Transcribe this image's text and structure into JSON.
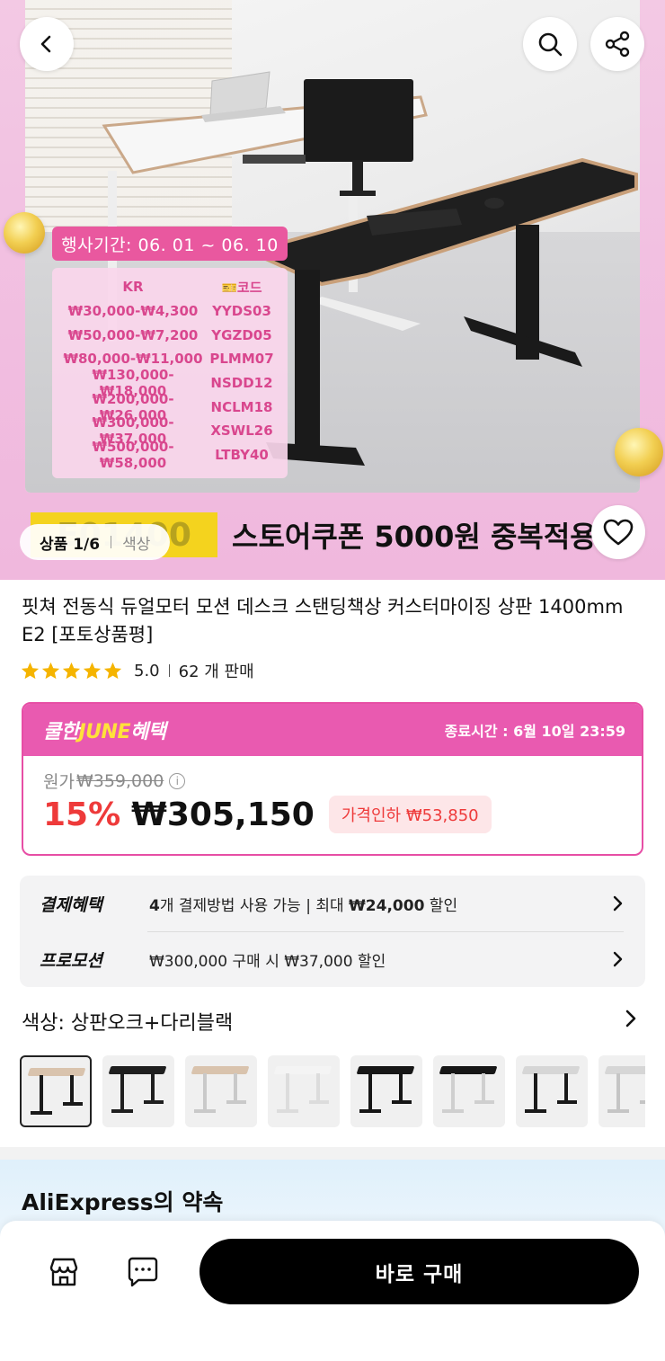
{
  "hero": {
    "event_period": "행사기간: 06. 01 ~ 06. 10",
    "coupon_header": {
      "range": "KR",
      "code": "코드"
    },
    "coupons": [
      {
        "range": "₩30,000-₩4,300",
        "code": "YYDS03"
      },
      {
        "range": "₩50,000-₩7,200",
        "code": "YGZD05"
      },
      {
        "range": "₩80,000-₩11,000",
        "code": "PLMM07"
      },
      {
        "range": "₩130,000-₩18,000",
        "code": "NSDD12"
      },
      {
        "range": "₩200,000-₩26,000",
        "code": "NCLM18"
      },
      {
        "range": "₩300,000-₩37,000",
        "code": "XSWL26"
      },
      {
        "range": "₩500,000-₩58,000",
        "code": "LTBY40"
      }
    ],
    "code_box": "E01400",
    "store_coupon": "스토어쿠폰 5000원 중복적용",
    "pager": {
      "label": "상품 1/6",
      "option": "색상"
    }
  },
  "product": {
    "title": "핏쳐 전동식 듀얼모터 모션 데스크 스탠딩책상 커스터마이징 상판 1400mm E2 [포토상품평]",
    "rating": "5.0",
    "sold": "62 개 판매"
  },
  "june": {
    "logo_pre": "쿨한",
    "logo_mid": "JUNE",
    "logo_post": "혜택",
    "end_time": "종료시간 : 6월 10일 23:59",
    "orig_label": "원가",
    "orig_price": "₩359,000",
    "discount": "15%",
    "price": "₩305,150",
    "price_cut": "가격인하 ₩53,850"
  },
  "benefits": {
    "pay_label": "결제혜택",
    "pay_count": "4",
    "pay_text_1": "개 결제방법 사용 가능 | 최대 ",
    "pay_amount": "₩24,000",
    "pay_text_2": " 할인",
    "promo_label": "프로모션",
    "promo_text": "₩300,000 구매 시 ₩37,000 할인"
  },
  "color": {
    "title": "색상: 상판오크+다리블랙",
    "swatches": [
      {
        "top": "#d9c3ad",
        "leg": "#1a1a1a"
      },
      {
        "top": "#1f1f1f",
        "leg": "#1f1f1f"
      },
      {
        "top": "#d9c3ad",
        "leg": "#c9c9c9"
      },
      {
        "top": "#f4f4f4",
        "leg": "#dcdcdc"
      },
      {
        "top": "#161616",
        "leg": "#161616"
      },
      {
        "top": "#161616",
        "leg": "#cfcfcf"
      },
      {
        "top": "#d6d6d6",
        "leg": "#1a1a1a"
      },
      {
        "top": "#d6d6d6",
        "leg": "#c5c5c5"
      }
    ]
  },
  "promise": {
    "title": "AliExpress의 약속"
  },
  "bottom": {
    "buy_label": "바로 구매"
  },
  "icons": [
    "back-icon",
    "search-icon",
    "share-icon",
    "heart-icon",
    "info-icon",
    "chevron-right-icon",
    "store-icon",
    "chat-icon",
    "star-icon"
  ],
  "colors": {
    "pink": "#e95ab0",
    "red": "#ee3a3a",
    "star": "#f5b400",
    "black": "#000000"
  }
}
